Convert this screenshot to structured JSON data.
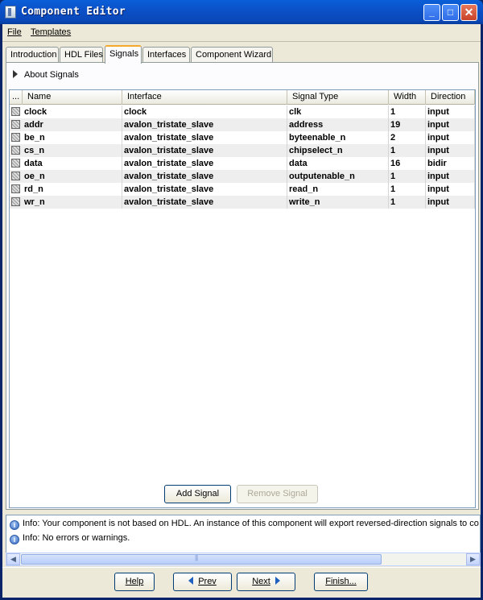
{
  "window": {
    "title": "Component Editor"
  },
  "menu": {
    "file": "File",
    "templates": "Templates"
  },
  "tabs": [
    "Introduction",
    "HDL Files",
    "Signals",
    "Interfaces",
    "Component Wizard"
  ],
  "active_tab": "Signals",
  "panel": {
    "about": "About Signals"
  },
  "table": {
    "headers": {
      "grip": "...",
      "name": "Name",
      "interface": "Interface",
      "signal_type": "Signal Type",
      "width": "Width",
      "direction": "Direction"
    },
    "rows": [
      {
        "name": "clock",
        "interface": "clock",
        "signal_type": "clk",
        "width": "1",
        "direction": "input"
      },
      {
        "name": "addr",
        "interface": "avalon_tristate_slave",
        "signal_type": "address",
        "width": "19",
        "direction": "input"
      },
      {
        "name": "be_n",
        "interface": "avalon_tristate_slave",
        "signal_type": "byteenable_n",
        "width": "2",
        "direction": "input"
      },
      {
        "name": "cs_n",
        "interface": "avalon_tristate_slave",
        "signal_type": "chipselect_n",
        "width": "1",
        "direction": "input"
      },
      {
        "name": "data",
        "interface": "avalon_tristate_slave",
        "signal_type": "data",
        "width": "16",
        "direction": "bidir"
      },
      {
        "name": "oe_n",
        "interface": "avalon_tristate_slave",
        "signal_type": "outputenable_n",
        "width": "1",
        "direction": "input"
      },
      {
        "name": "rd_n",
        "interface": "avalon_tristate_slave",
        "signal_type": "read_n",
        "width": "1",
        "direction": "input"
      },
      {
        "name": "wr_n",
        "interface": "avalon_tristate_slave",
        "signal_type": "write_n",
        "width": "1",
        "direction": "input"
      }
    ]
  },
  "buttons": {
    "add_signal": "Add Signal",
    "remove_signal": "Remove Signal"
  },
  "messages": [
    "Info: Your component is not based on HDL. An instance of this component will export reversed-direction signals to co",
    "Info: No errors or warnings."
  ],
  "nav": {
    "help": "Help",
    "prev": "Prev",
    "next": "Next",
    "finish": "Finish..."
  }
}
